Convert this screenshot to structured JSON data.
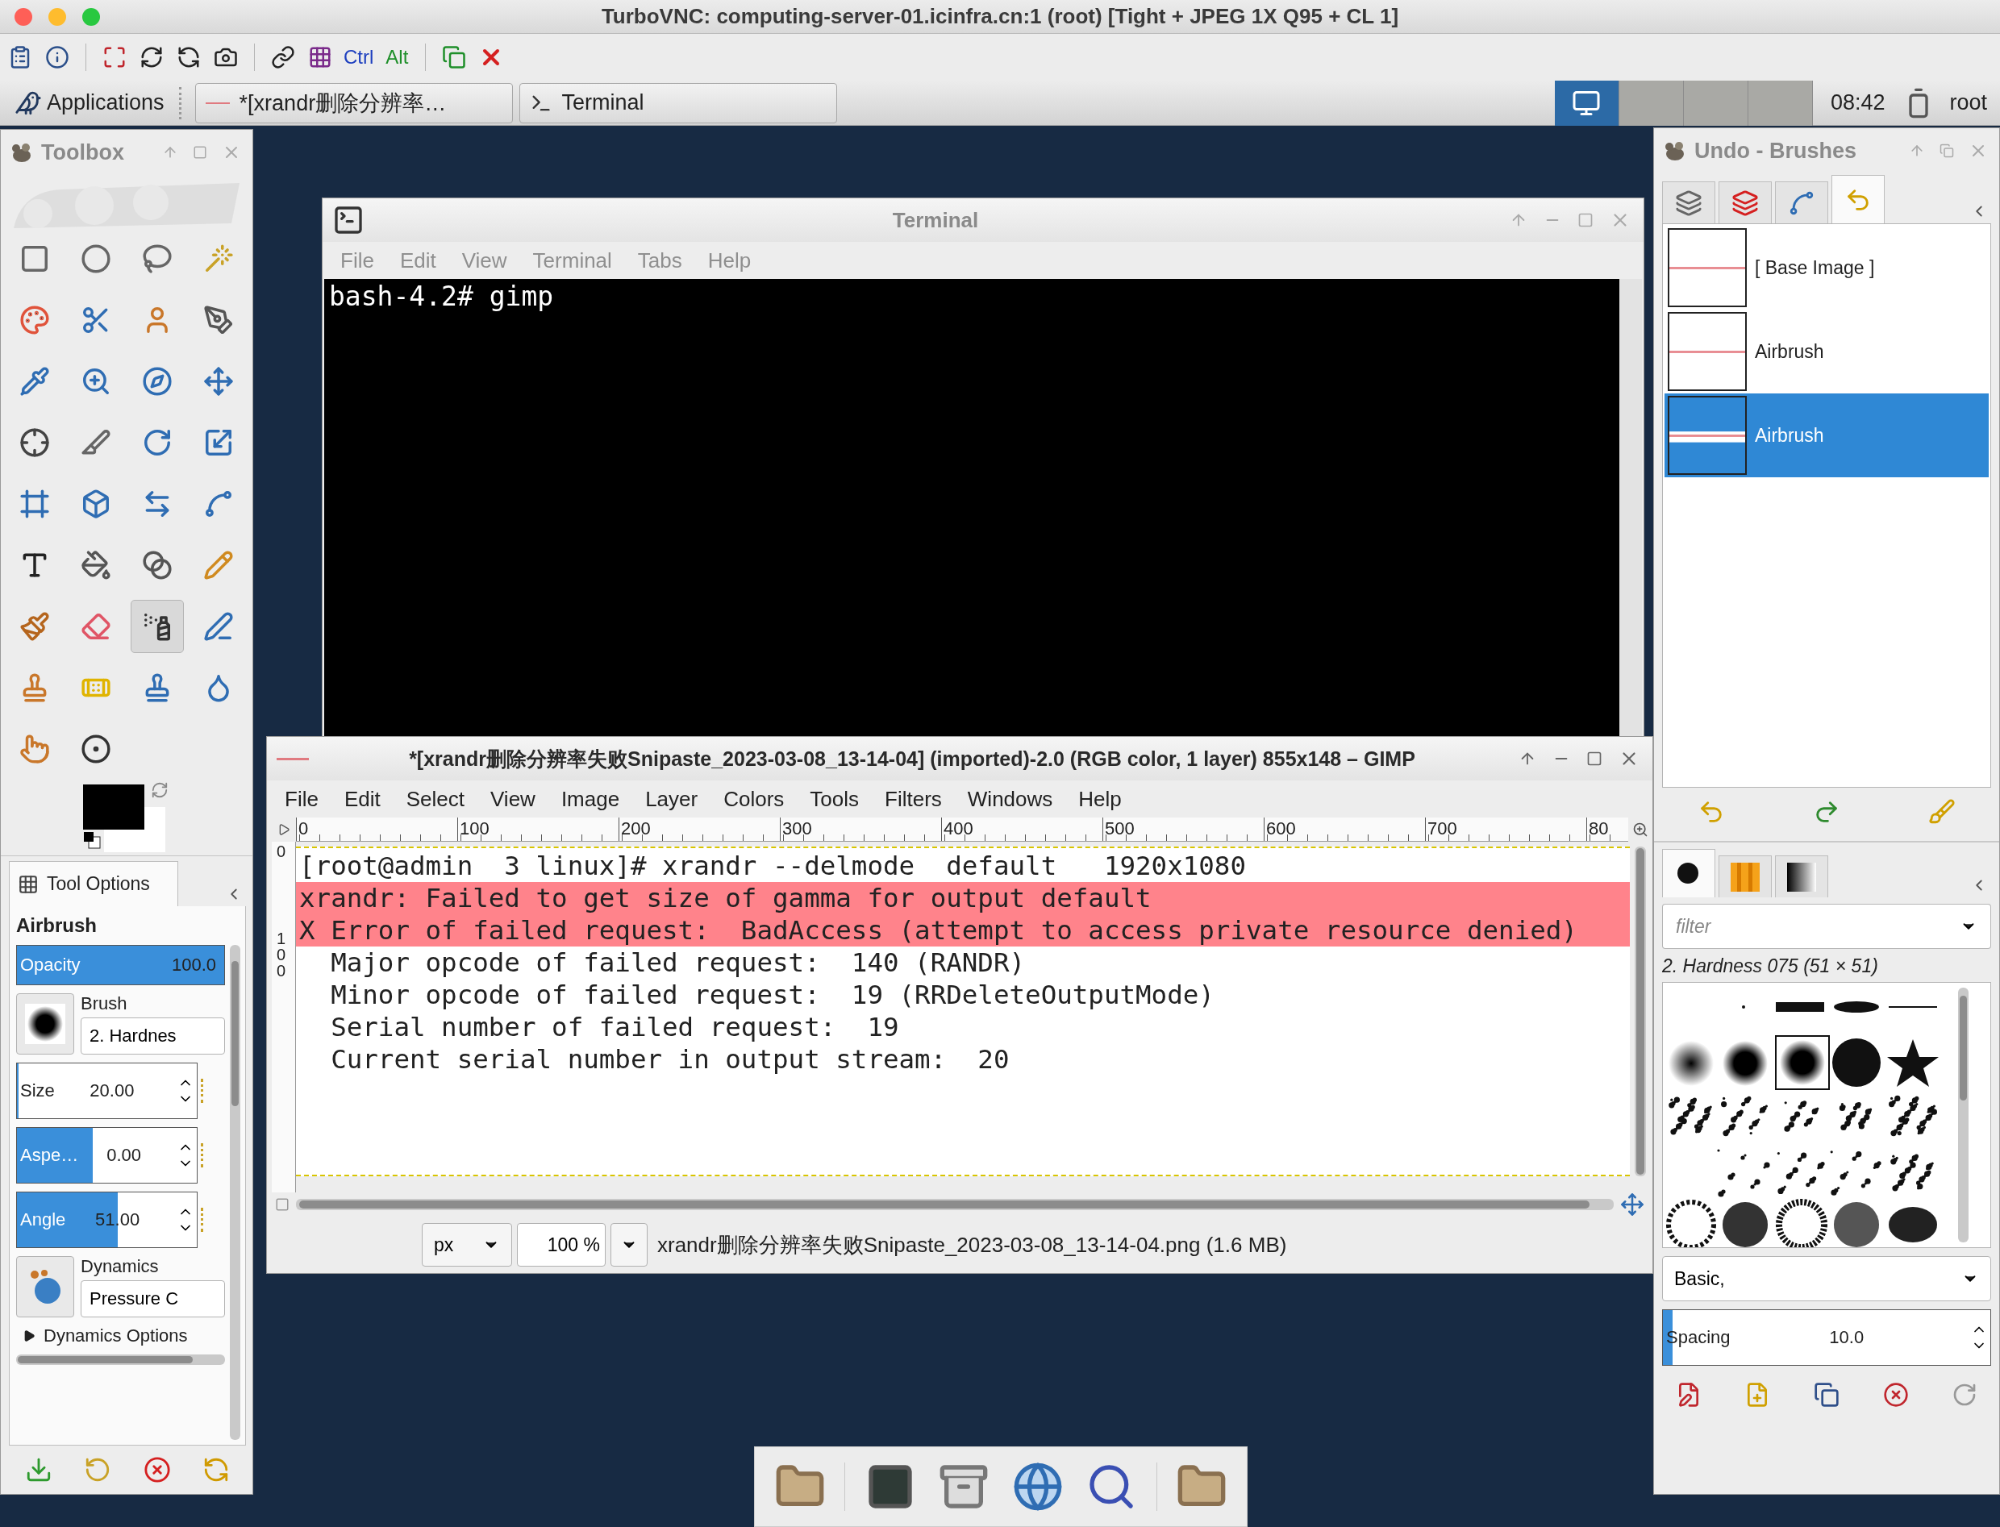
{
  "vnc_window": {
    "title": "TurboVNC: computing-server-01.icinfra.cn:1 (root) [Tight + JPEG 1X Q95 + CL 1]"
  },
  "vnc_toolbar": {
    "ctrl_key": "Ctrl",
    "alt_key": "Alt"
  },
  "panel": {
    "applications": "Applications",
    "tasks": [
      "*[xrandr删除分辨率…",
      "Terminal"
    ],
    "workspaces": [
      {
        "selected": true
      },
      {
        "selected": false
      },
      {
        "selected": false
      },
      {
        "selected": false
      }
    ],
    "clock": "08:42",
    "user": "root"
  },
  "toolbox": {
    "title": "Toolbox",
    "tools": [
      {
        "selected": false
      },
      {
        "selected": false
      },
      {
        "selected": false
      },
      {
        "selected": false
      },
      {
        "selected": false
      },
      {
        "selected": false
      },
      {
        "selected": false
      },
      {
        "selected": false
      },
      {
        "selected": false
      },
      {
        "selected": false
      },
      {
        "selected": false
      },
      {
        "selected": false
      },
      {
        "selected": false
      },
      {
        "selected": false
      },
      {
        "selected": false
      },
      {
        "selected": false
      },
      {
        "selected": false
      },
      {
        "selected": false
      },
      {
        "selected": false
      },
      {
        "selected": false
      },
      {
        "selected": false
      },
      {
        "selected": false
      },
      {
        "selected": false
      },
      {
        "selected": false
      },
      {
        "selected": false
      },
      {
        "selected": false
      },
      {
        "selected": true
      },
      {
        "selected": false
      },
      {
        "selected": false
      },
      {
        "selected": false
      },
      {
        "selected": false
      },
      {
        "selected": false
      },
      {
        "selected": false
      },
      {
        "selected": false
      }
    ],
    "tool_options": {
      "tab": "Tool Options",
      "tool_name": "Airbrush",
      "controls": [
        {
          "kind": "bar",
          "label": "Opacity",
          "value": "100.0",
          "level": 1
        },
        {
          "kind": "brush",
          "label": "Brush",
          "value": "2. Hardnes"
        },
        {
          "kind": "spin",
          "label": "Size",
          "value": "20.00",
          "level": 0.01
        },
        {
          "kind": "spin",
          "label": "Aspe…",
          "value": "0.00",
          "level": 0.42
        },
        {
          "kind": "spin",
          "label": "Angle",
          "value": "51.00",
          "level": 0.56
        },
        {
          "kind": "dynamics",
          "label": "Dynamics",
          "value": "Pressure C"
        }
      ],
      "expander": {
        "label": "Dynamics Options",
        "expanded": false
      }
    }
  },
  "terminal": {
    "title": "Terminal",
    "menus": [
      "File",
      "Edit",
      "View",
      "Terminal",
      "Tabs",
      "Help"
    ],
    "lines": [
      "bash-4.2# gimp"
    ]
  },
  "gimp_window": {
    "title": "*[xrandr删除分辨率失败Snipaste_2023-03-08_13-14-04] (imported)-2.0 (RGB color, 1 layer) 855x148 – GIMP",
    "menus": [
      "File",
      "Edit",
      "Select",
      "View",
      "Image",
      "Layer",
      "Colors",
      "Tools",
      "Filters",
      "Windows",
      "Help"
    ],
    "ruler_labels": [
      "0",
      "100",
      "200",
      "300",
      "400",
      "500",
      "600",
      "700",
      "80"
    ],
    "vertical_ruler_labels": [
      "0",
      "100"
    ],
    "lines": [
      {
        "text": "[root@admin  3 linux]# xrandr --delmode  default   1920x1080",
        "highlighted": false
      },
      {
        "text": "xrandr: Failed to get size of gamma for output default",
        "highlighted": true
      },
      {
        "text": "X Error of failed request:  BadAccess (attempt to access private resource denied)",
        "highlighted": true
      },
      {
        "text": "  Major opcode of failed request:  140 (RANDR)",
        "highlighted": false
      },
      {
        "text": "  Minor opcode of failed request:  19 (RRDeleteOutputMode)",
        "highlighted": false
      },
      {
        "text": "  Serial number of failed request:  19",
        "highlighted": false
      },
      {
        "text": "  Current serial number in output stream:  20",
        "highlighted": false
      }
    ],
    "status": {
      "unit": "px",
      "zoom": "100 %",
      "file": "xrandr删除分辨率失败Snipaste_2023-03-08_13-14-04.png (1.6 MB)"
    }
  },
  "undo_dock": {
    "title": "Undo - Brushes",
    "tabs": [
      {
        "selected": false
      },
      {
        "selected": false
      },
      {
        "selected": false
      },
      {
        "selected": true
      }
    ],
    "history": [
      {
        "label": "[ Base Image ]",
        "selected": false
      },
      {
        "label": "Airbrush",
        "selected": false
      },
      {
        "label": "Airbrush",
        "selected": true
      }
    ],
    "brush_tabs": [
      {
        "selected": true
      },
      {
        "selected": false
      },
      {
        "selected": false
      }
    ],
    "filter": {
      "placeholder": "filter"
    },
    "brush_name": "2. Hardness 075 (51 × 51)",
    "preset": "Basic,",
    "spacing": {
      "label": "Spacing",
      "value": "10.0",
      "level": 0.03
    }
  }
}
